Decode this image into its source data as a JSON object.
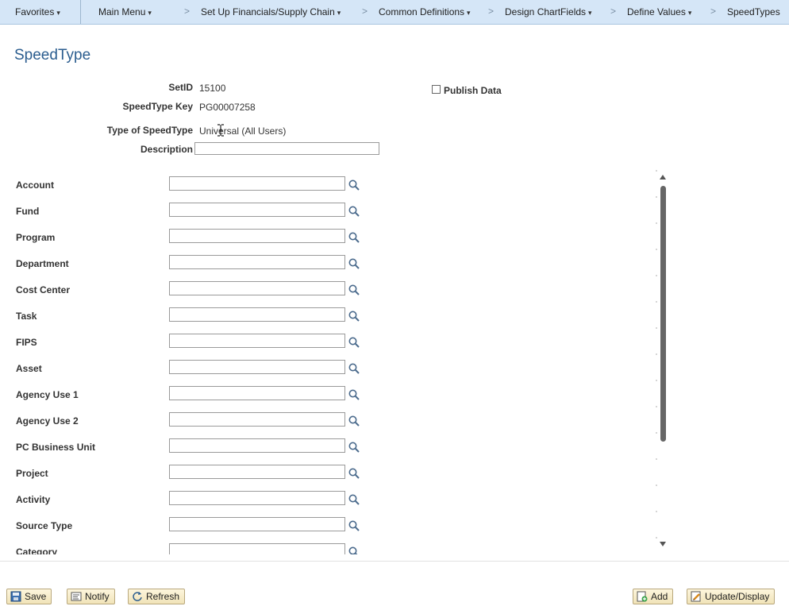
{
  "nav": {
    "favorites": "Favorites",
    "main_menu": "Main Menu",
    "crumbs": [
      "Set Up Financials/Supply Chain",
      "Common Definitions",
      "Design ChartFields",
      "Define Values"
    ],
    "last": "SpeedTypes",
    "caret": "▾",
    "separator": ">"
  },
  "page": {
    "title": "SpeedType"
  },
  "header": {
    "setid_label": "SetID",
    "setid_value": "15100",
    "key_label": "SpeedType Key",
    "key_value": "PG00007258",
    "type_label": "Type of SpeedType",
    "type_value": "Universal (All Users)",
    "description_label": "Description",
    "description_value": "",
    "publish_label": "Publish Data",
    "publish_checked": false
  },
  "fields": [
    {
      "label": "Account",
      "value": ""
    },
    {
      "label": "Fund",
      "value": ""
    },
    {
      "label": "Program",
      "value": ""
    },
    {
      "label": "Department",
      "value": ""
    },
    {
      "label": "Cost Center",
      "value": ""
    },
    {
      "label": "Task",
      "value": ""
    },
    {
      "label": "FIPS",
      "value": ""
    },
    {
      "label": "Asset",
      "value": ""
    },
    {
      "label": "Agency Use 1",
      "value": ""
    },
    {
      "label": "Agency Use 2",
      "value": ""
    },
    {
      "label": "PC Business Unit",
      "value": ""
    },
    {
      "label": "Project",
      "value": ""
    },
    {
      "label": "Activity",
      "value": ""
    },
    {
      "label": "Source Type",
      "value": ""
    },
    {
      "label": "Category",
      "value": ""
    }
  ],
  "toolbar": {
    "save": "Save",
    "notify": "Notify",
    "refresh": "Refresh",
    "add": "Add",
    "update_display": "Update/Display"
  },
  "colors": {
    "nav_bg": "#d5e6f7",
    "title": "#2b5d8f",
    "button_bg": "#f1e4b8"
  }
}
